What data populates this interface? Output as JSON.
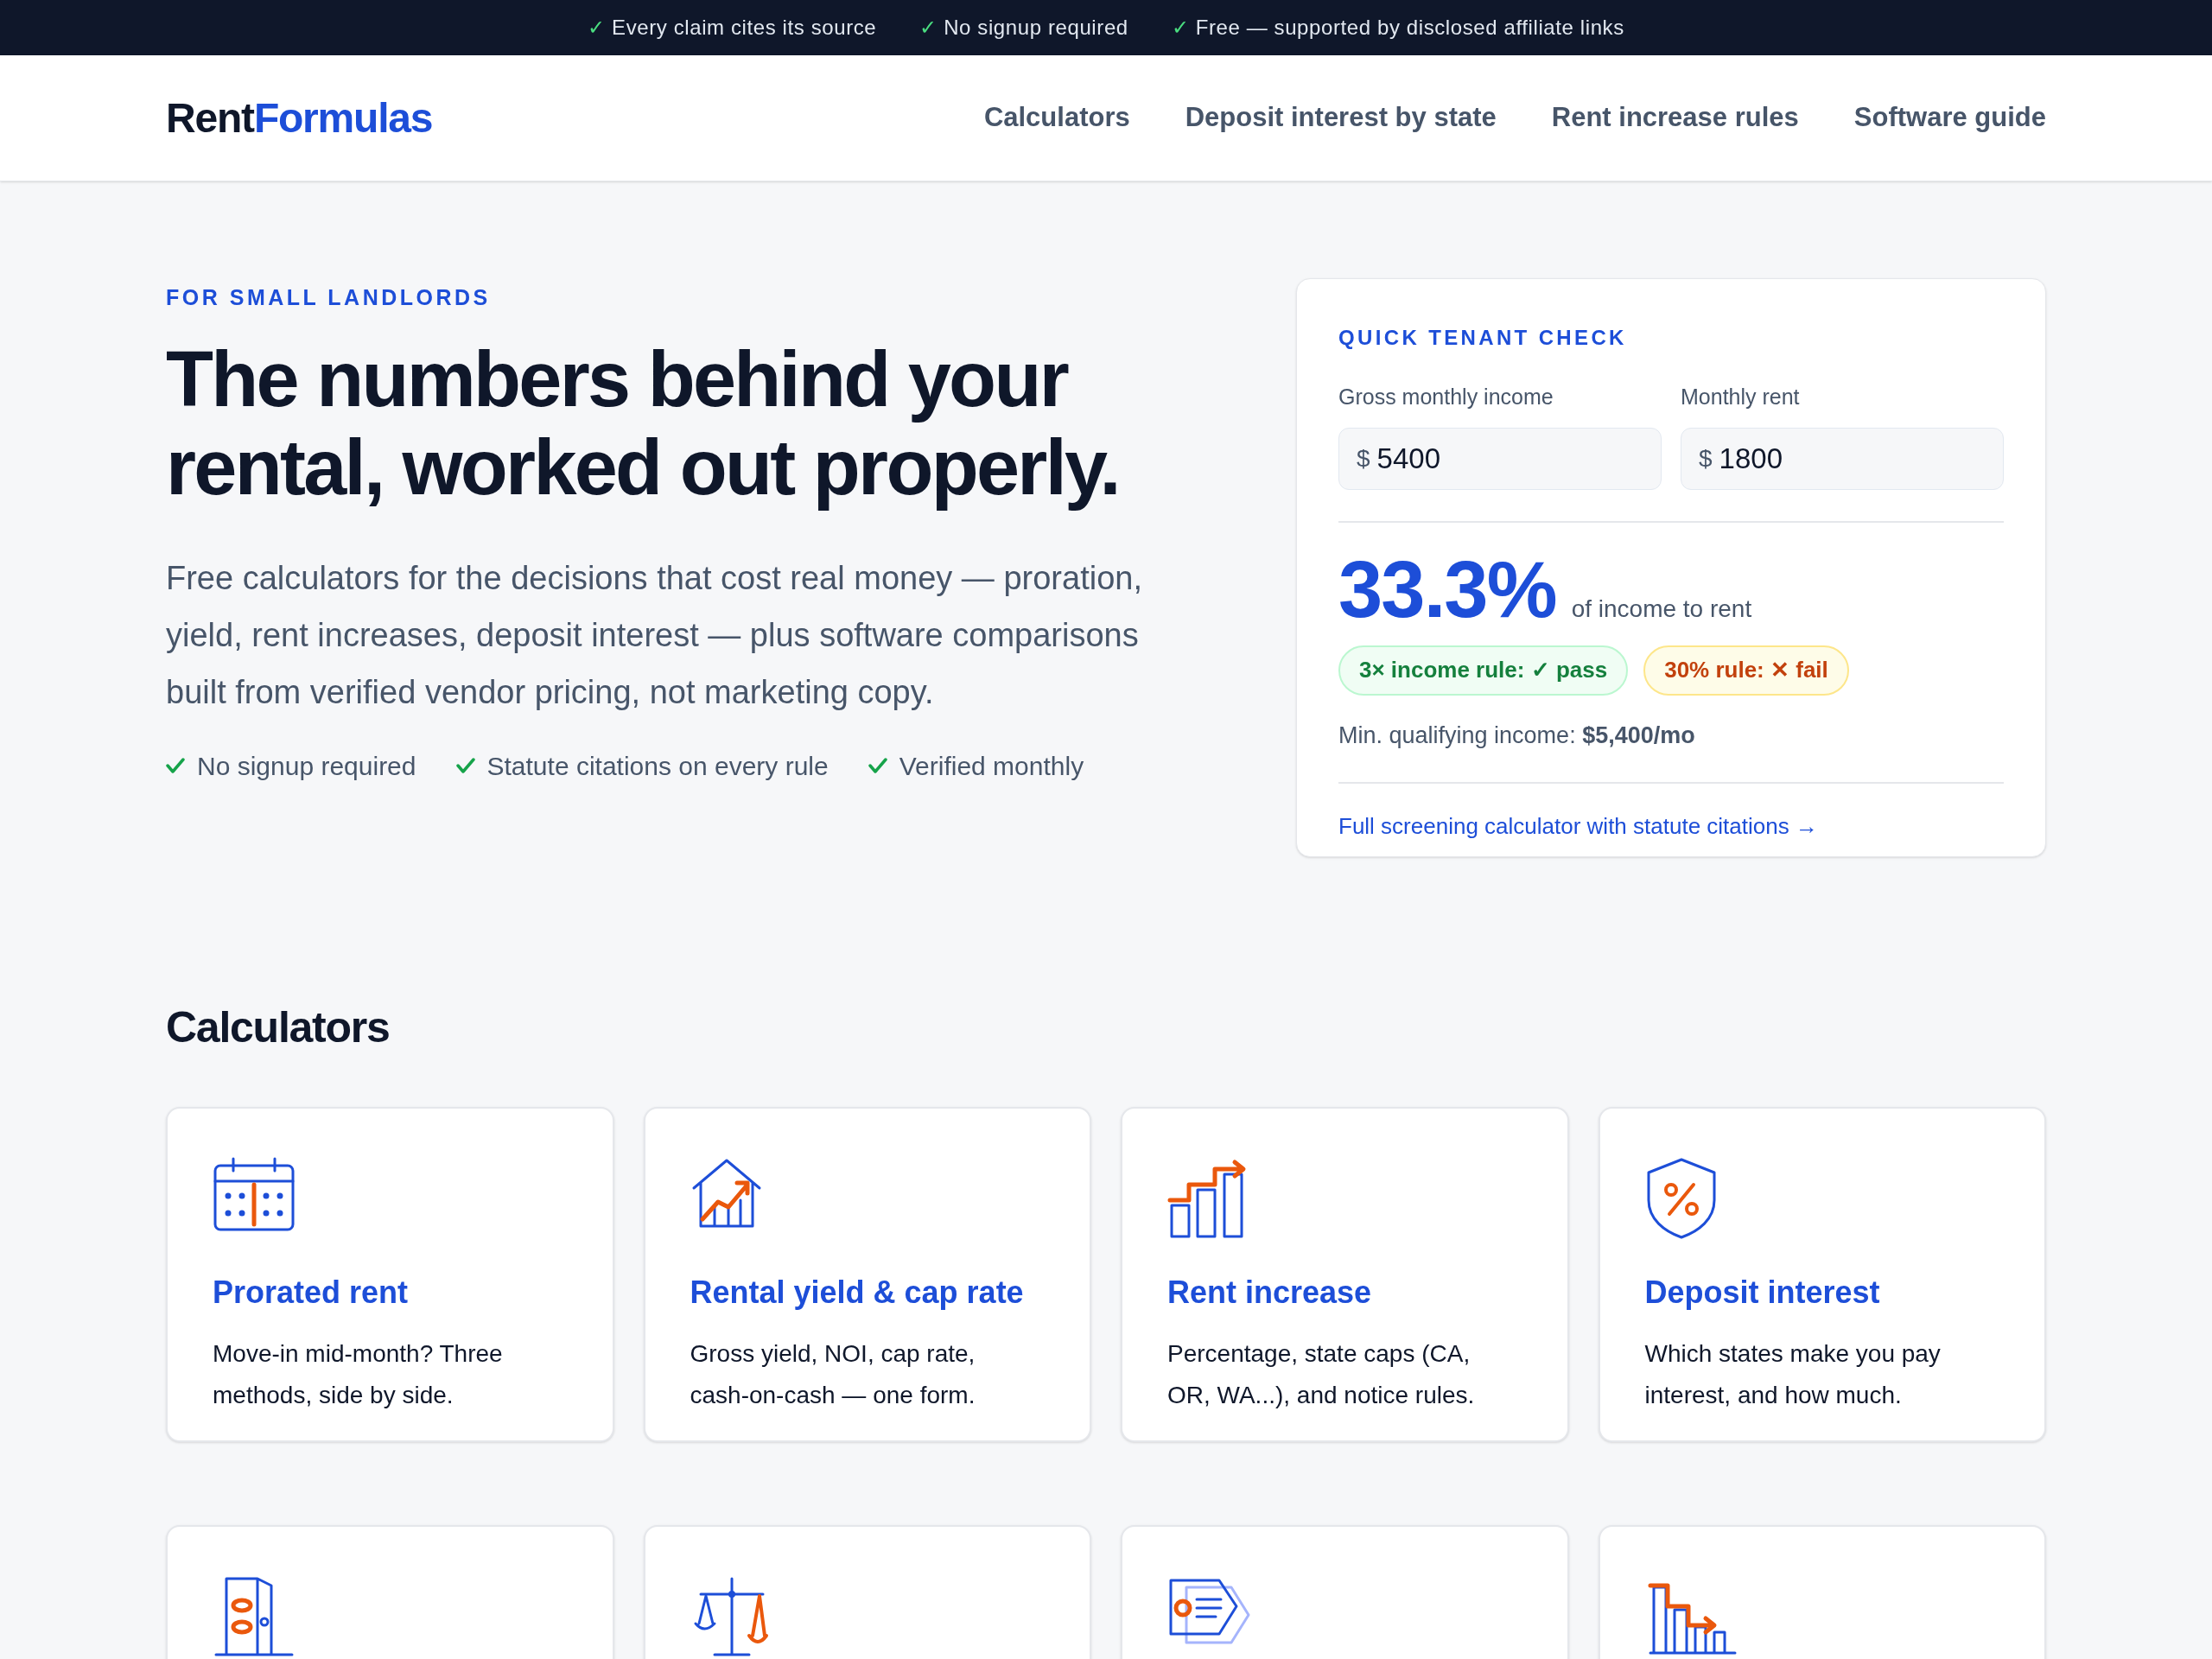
{
  "top_bar": {
    "check": "✓",
    "items": [
      "Every claim cites its source",
      "No signup required",
      "Free — supported by disclosed affiliate links"
    ]
  },
  "header": {
    "logo": {
      "part_1": "Rent",
      "part_2": "Formulas"
    },
    "nav": [
      "Calculators",
      "Deposit interest by state",
      "Rent increase rules",
      "Software guide"
    ]
  },
  "hero": {
    "eyebrow": "FOR SMALL LANDLORDS",
    "title": "The numbers behind your rental, worked out properly.",
    "lead": "Free calculators for the decisions that cost real money — proration, yield, rent increases, deposit interest — plus software comparisons built from verified vendor pricing, not marketing copy.",
    "checks": [
      "No signup required",
      "Statute citations on every rule",
      "Verified monthly"
    ]
  },
  "tenant_check": {
    "title": "QUICK TENANT CHECK",
    "fields": [
      {
        "label": "Gross monthly income",
        "prefix": "$",
        "value": "5400"
      },
      {
        "label": "Monthly rent",
        "prefix": "$",
        "value": "1800"
      }
    ],
    "result": "33.3%",
    "result_caption": "of income to rent",
    "badges": [
      {
        "text": "3× income rule: ✓ pass",
        "kind": "pass"
      },
      {
        "text": "30% rule: ✕ fail",
        "kind": "fail"
      }
    ],
    "min_income": "Min. qualifying income: **$5,400/mo**",
    "link": "Full screening calculator with statute citations →"
  },
  "calculators": {
    "heading": "Calculators",
    "cards": [
      {
        "kind": "calculator",
        "title": "Prorated rent",
        "text": "Move-in mid-month? Three methods, side by side."
      },
      {
        "kind": "calculator",
        "title": "Rental yield & cap rate",
        "text": "Gross yield, NOI, cap rate, cash-on-cash — one form."
      },
      {
        "kind": "calculator",
        "title": "Rent increase",
        "text": "Percentage, state caps (CA, OR, WA...), and notice rules."
      },
      {
        "kind": "calculator",
        "title": "Deposit interest",
        "text": "Which states make you pay interest, and how much."
      },
      {
        "kind": "calculator"
      },
      {
        "kind": "calculator"
      },
      {
        "kind": "calculator"
      },
      {
        "kind": "calculator"
      }
    ]
  }
}
